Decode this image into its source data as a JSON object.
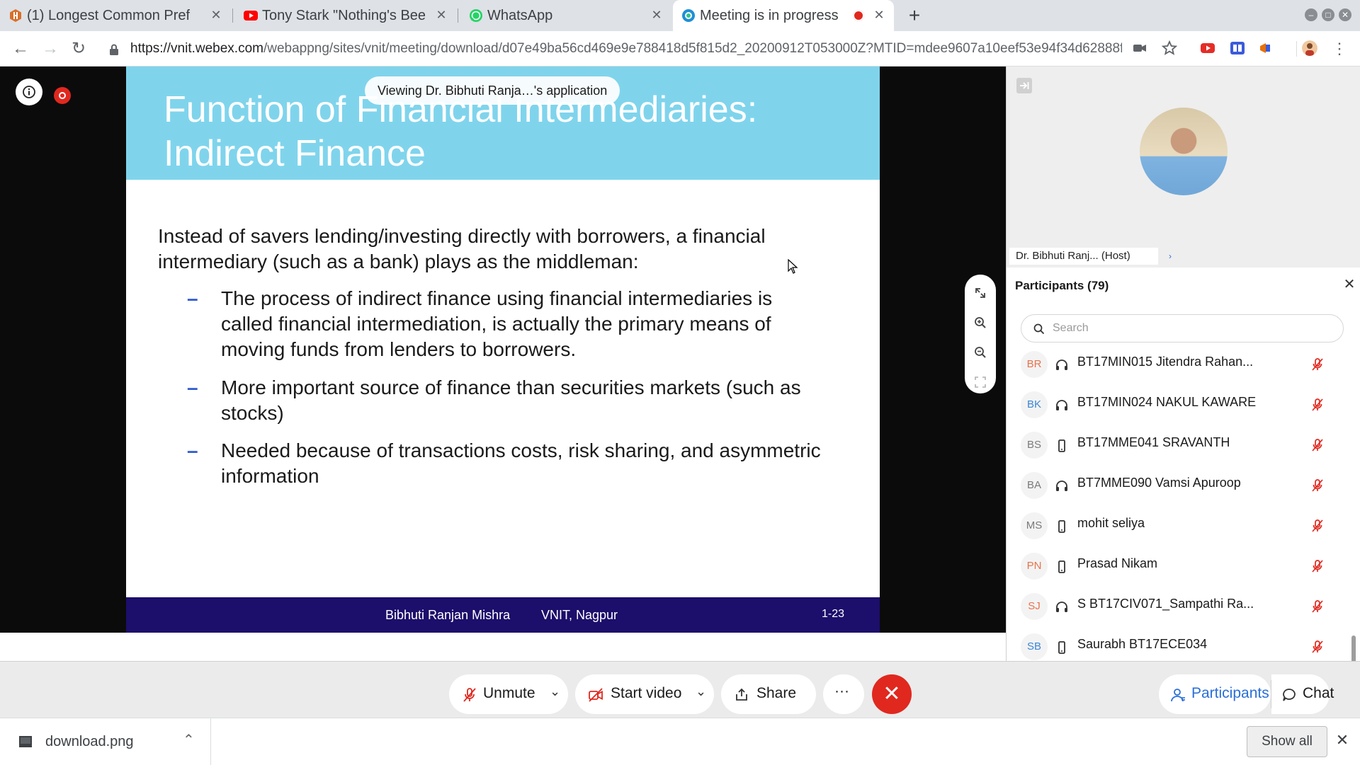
{
  "browser": {
    "tabs": [
      {
        "label": "(1) Longest Common Pref",
        "icon": "hackerrank-like-favicon"
      },
      {
        "label": "Tony Stark \"Nothing's Bee",
        "icon": "youtube-icon"
      },
      {
        "label": "WhatsApp",
        "icon": "whatsapp-icon"
      },
      {
        "label": "Meeting is in progress",
        "icon": "webex-icon",
        "recording": true
      }
    ],
    "new_tab": "+",
    "url_host": "https://vnit.webex.com",
    "url_path": "/webappng/sites/vnit/meeting/download/d07e49ba56cd469e9e788418d5f815d2_20200912T053000Z?MTID=mdee9607a10eef53e94f34d62888f5...",
    "colors": {
      "accent": "#2a6fd6",
      "danger": "#e0281f",
      "slide_header": "#7fd4ec",
      "slide_footer": "#1c0e6b"
    }
  },
  "meeting": {
    "viewing": "Viewing Dr. Bibhuti Ranja…'s application",
    "slide": {
      "title": "Function of Financial Intermediaries: Indirect Finance",
      "intro": "Instead of savers lending/investing directly with borrowers, a financial intermediary (such as a bank) plays as the middleman:",
      "bullets": [
        "The process of indirect finance using financial intermediaries is called financial intermediation, is actually the primary means of moving funds from lenders to borrowers.",
        "More important source of finance than securities markets (such as stocks)",
        "Needed because of transactions costs, risk sharing, and asymmetric information"
      ],
      "bullet_dash": "–",
      "footer_author": "Bibhuti Ranjan Mishra",
      "footer_school": "VNIT, Nagpur",
      "footer_page": "1-23"
    },
    "host_label": "Dr. Bibhuti Ranj... (Host)",
    "host_arrow": "›"
  },
  "participants": {
    "title": "Participants (79)",
    "close": "✕",
    "search_placeholder": "Search",
    "items": [
      {
        "initials": "BR",
        "name": "BT17MIN015 Jitendra Rahan...",
        "device": "headset",
        "color": "#e8734d"
      },
      {
        "initials": "BK",
        "name": "BT17MIN024 NAKUL KAWARE",
        "device": "headset",
        "color": "#3b86d6"
      },
      {
        "initials": "BS",
        "name": "BT17MME041 SRAVANTH",
        "device": "phone",
        "color": "#7a7a7a"
      },
      {
        "initials": "BA",
        "name": "BT7MME090 Vamsi Apuroop",
        "device": "headset",
        "color": "#7a7a7a"
      },
      {
        "initials": "MS",
        "name": "mohit seliya",
        "device": "phone",
        "color": "#7a7a7a"
      },
      {
        "initials": "PN",
        "name": "Prasad Nikam",
        "device": "phone",
        "color": "#e8734d"
      },
      {
        "initials": "SJ",
        "name": "S BT17CIV071_Sampathi Ra...",
        "device": "headset",
        "color": "#e8734d"
      },
      {
        "initials": "SB",
        "name": "Saurabh BT17ECE034",
        "device": "phone",
        "color": "#3b86d6"
      }
    ]
  },
  "controls": {
    "unmute": "Unmute",
    "start_video": "Start video",
    "share": "Share",
    "more": "···",
    "end": "✕",
    "participants": "Participants",
    "chat": "Chat"
  },
  "downloads": {
    "file": "download.png",
    "show_all": "Show all",
    "close": "✕"
  }
}
